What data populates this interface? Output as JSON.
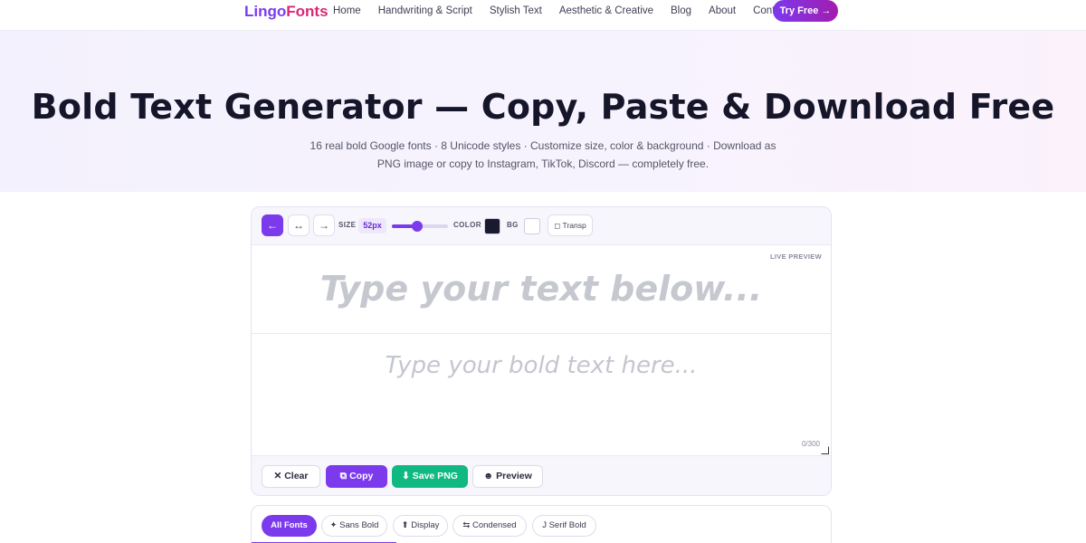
{
  "nav": {
    "logo_main": "Lingo",
    "logo_accent": "Fonts",
    "links": [
      "Home",
      "Handwriting & Script",
      "Stylish Text",
      "Aesthetic & Creative",
      "Blog",
      "About",
      "Contact"
    ],
    "cta": "Try Free →"
  },
  "hero": {
    "title": "Bold Text Generator — Copy, Paste & Download Free",
    "subtitle": "16 real bold Google fonts · 8 Unicode styles · Customize size, color & background · Download as PNG image or copy to Instagram, TikTok, Discord — completely free."
  },
  "toolbar": {
    "align_left": "←",
    "align_center": "↔",
    "align_right": "→",
    "size_label": "SIZE",
    "size_value": "52px",
    "size_fraction": 0.45,
    "color_label": "COLOR",
    "bg_label": "BG",
    "text_color": "#1a1a2e",
    "bg_color": "#ffffff",
    "transparent_label": "◻ Transp"
  },
  "preview": {
    "badge": "LIVE PREVIEW",
    "placeholder": "Type your text below..."
  },
  "input": {
    "placeholder": "Type your bold text here...",
    "counter": "0/300"
  },
  "actions": {
    "clear": "✕ Clear",
    "copy": "⧉ Copy",
    "save": "⬇ Save PNG",
    "preview": "☻ Preview"
  },
  "tabs": [
    "All Fonts",
    "✦ Sans Bold",
    "⬆ Display",
    "⇆ Condensed",
    "J Serif Bold"
  ],
  "colors": {
    "accent": "#7c3aed",
    "success": "#10b981"
  }
}
